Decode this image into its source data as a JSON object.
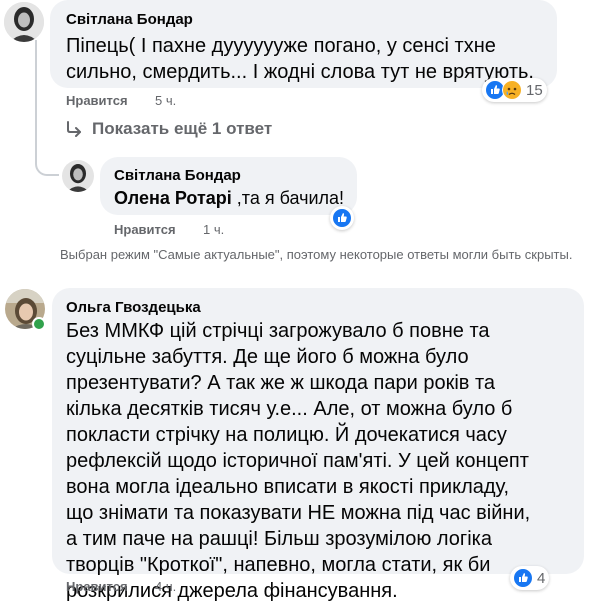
{
  "comments": [
    {
      "author": "Світлана Бондар",
      "text": "Піпець( І пахне дууууууже погано, у сенсі тхне сильно, смердить... І жодні слова тут не врятують.",
      "like_label": "Нравится",
      "time": "5 ч.",
      "reaction_count": "15"
    },
    {
      "author": "Світлана Бондар",
      "mention": "Олена Ротарі",
      "text": " ,та я бачила!",
      "like_label": "Нравится",
      "time": "1 ч."
    },
    {
      "author": "Ольга Гвоздецька",
      "text": "Без ММКФ цій стрічці загрожувало б повне та суцільне забуття. Де ще його б можна було презентувати? А так же ж шкода пари років та кілька десятків тисяч у.е... Але, от можна було б покласти стрічку на полицю. Й дочекатися часу рефлексій щодо історичної пам'яті. У цей концепт вона могла ідеально вписати в якості прикладу, що знімати та показувати НЕ можна під час війни, а тим паче на рашці! Більш зрозумілою логіка творців \"Кроткої\", напевно, могла стати, як би розкрилися джерела фінансування.",
      "like_label": "Нравится",
      "time": "4 ч.",
      "reaction_count": "4"
    }
  ],
  "show_more_replies": "Показать ещё 1 ответ",
  "filter_notice": "Выбран режим \"Самые актуальные\", поэтому некоторые ответы могли быть скрыты.",
  "colors": {
    "bubble": "#f0f2f5",
    "secondary_text": "#65676b",
    "like_blue": "#1877f2",
    "sad_yellow": "#f7b125",
    "online_green": "#31a24c"
  }
}
